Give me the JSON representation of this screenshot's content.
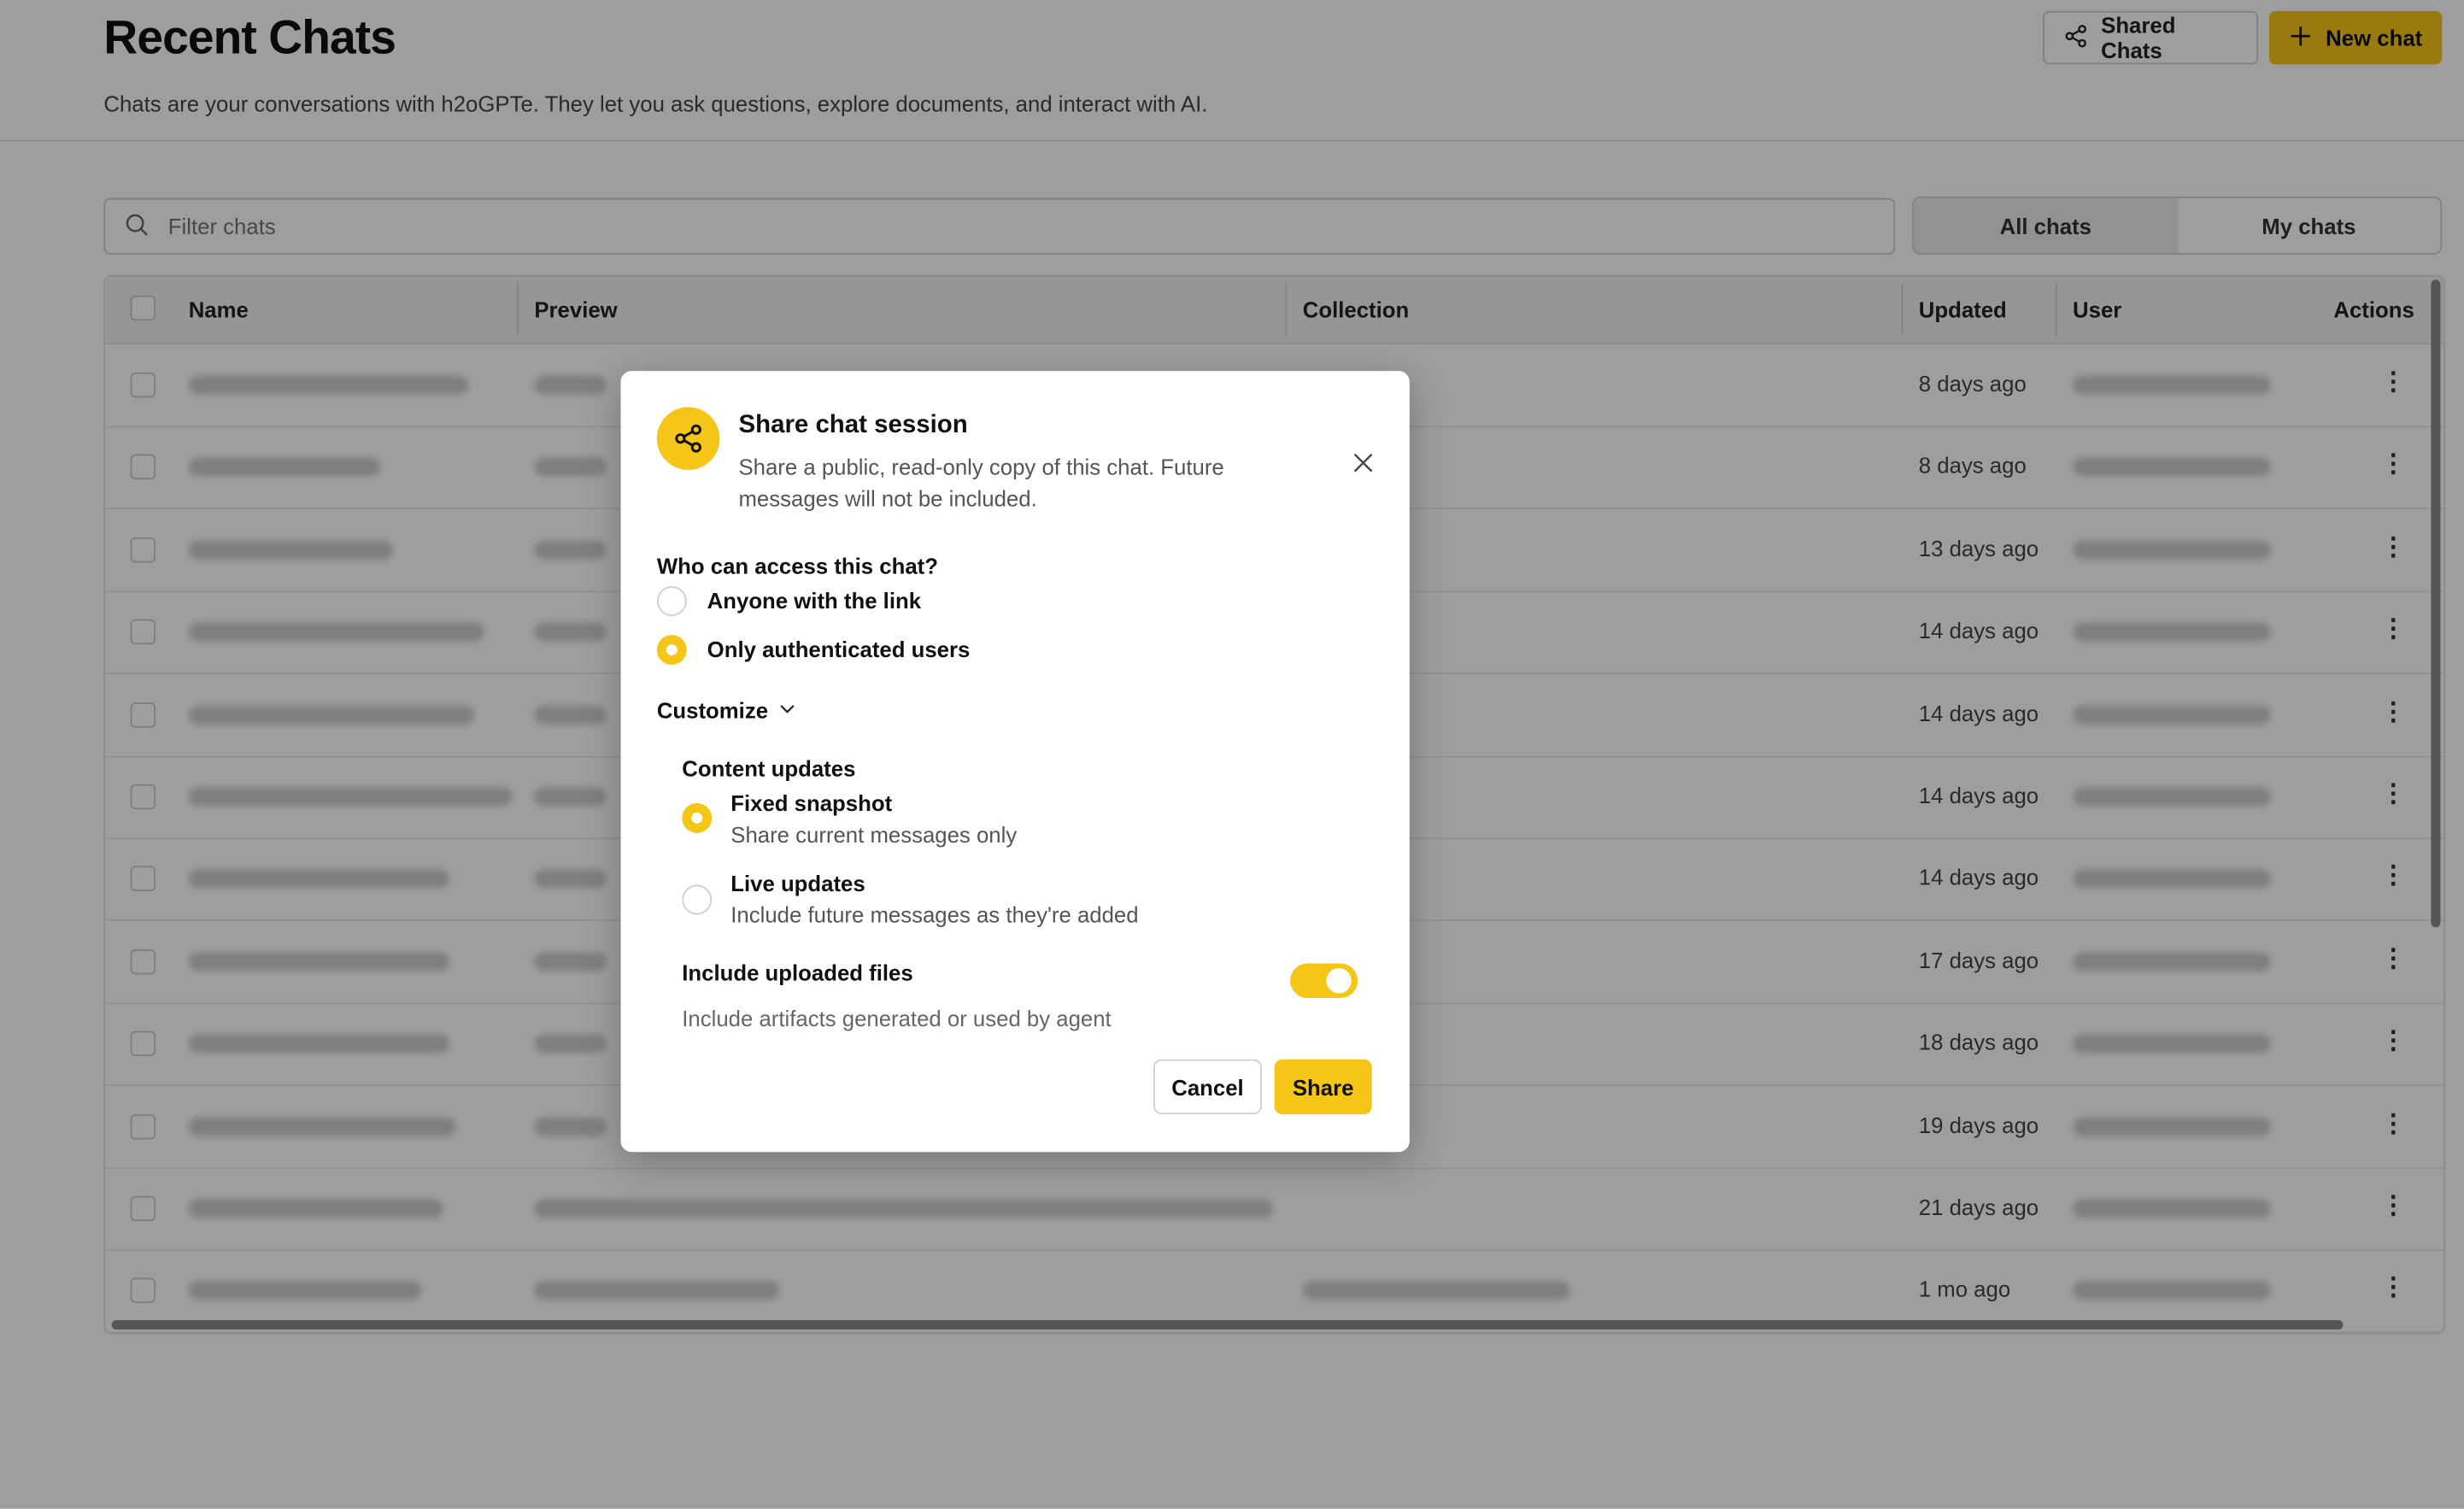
{
  "header": {
    "title": "Recent Chats",
    "subtitle": "Chats are your conversations with h2oGPTe. They let you ask questions, explore documents, and interact with AI.",
    "shared_chats_label": "Shared Chats",
    "new_chat_label": "New chat"
  },
  "filter": {
    "placeholder": "Filter chats"
  },
  "segment": {
    "all_label": "All chats",
    "mine_label": "My chats",
    "selected": "My chats"
  },
  "table": {
    "columns": [
      "Name",
      "Preview",
      "Collection",
      "Updated",
      "User",
      "Actions"
    ],
    "updated": [
      "8 days ago",
      "8 days ago",
      "13 days ago",
      "14 days ago",
      "14 days ago",
      "14 days ago",
      "14 days ago",
      "17 days ago",
      "18 days ago",
      "19 days ago",
      "21 days ago",
      "1 mo ago"
    ]
  },
  "modal": {
    "title": "Share chat session",
    "description": "Share a public, read-only copy of this chat. Future messages will not be included.",
    "access_question": "Who can access this chat?",
    "option_link": "Anyone with the link",
    "option_auth": "Only authenticated users",
    "access_selected": "Only authenticated users",
    "customize_label": "Customize",
    "content_updates_label": "Content updates",
    "fixed_title": "Fixed snapshot",
    "fixed_desc": "Share current messages only",
    "live_title": "Live updates",
    "live_desc": "Include future messages as they're added",
    "content_selected": "Fixed snapshot",
    "files_label": "Include uploaded files",
    "files_desc": "Include artifacts generated or used by agent",
    "files_enabled": true,
    "cancel_label": "Cancel",
    "share_label": "Share"
  },
  "colors": {
    "accent": "#f5c518"
  }
}
